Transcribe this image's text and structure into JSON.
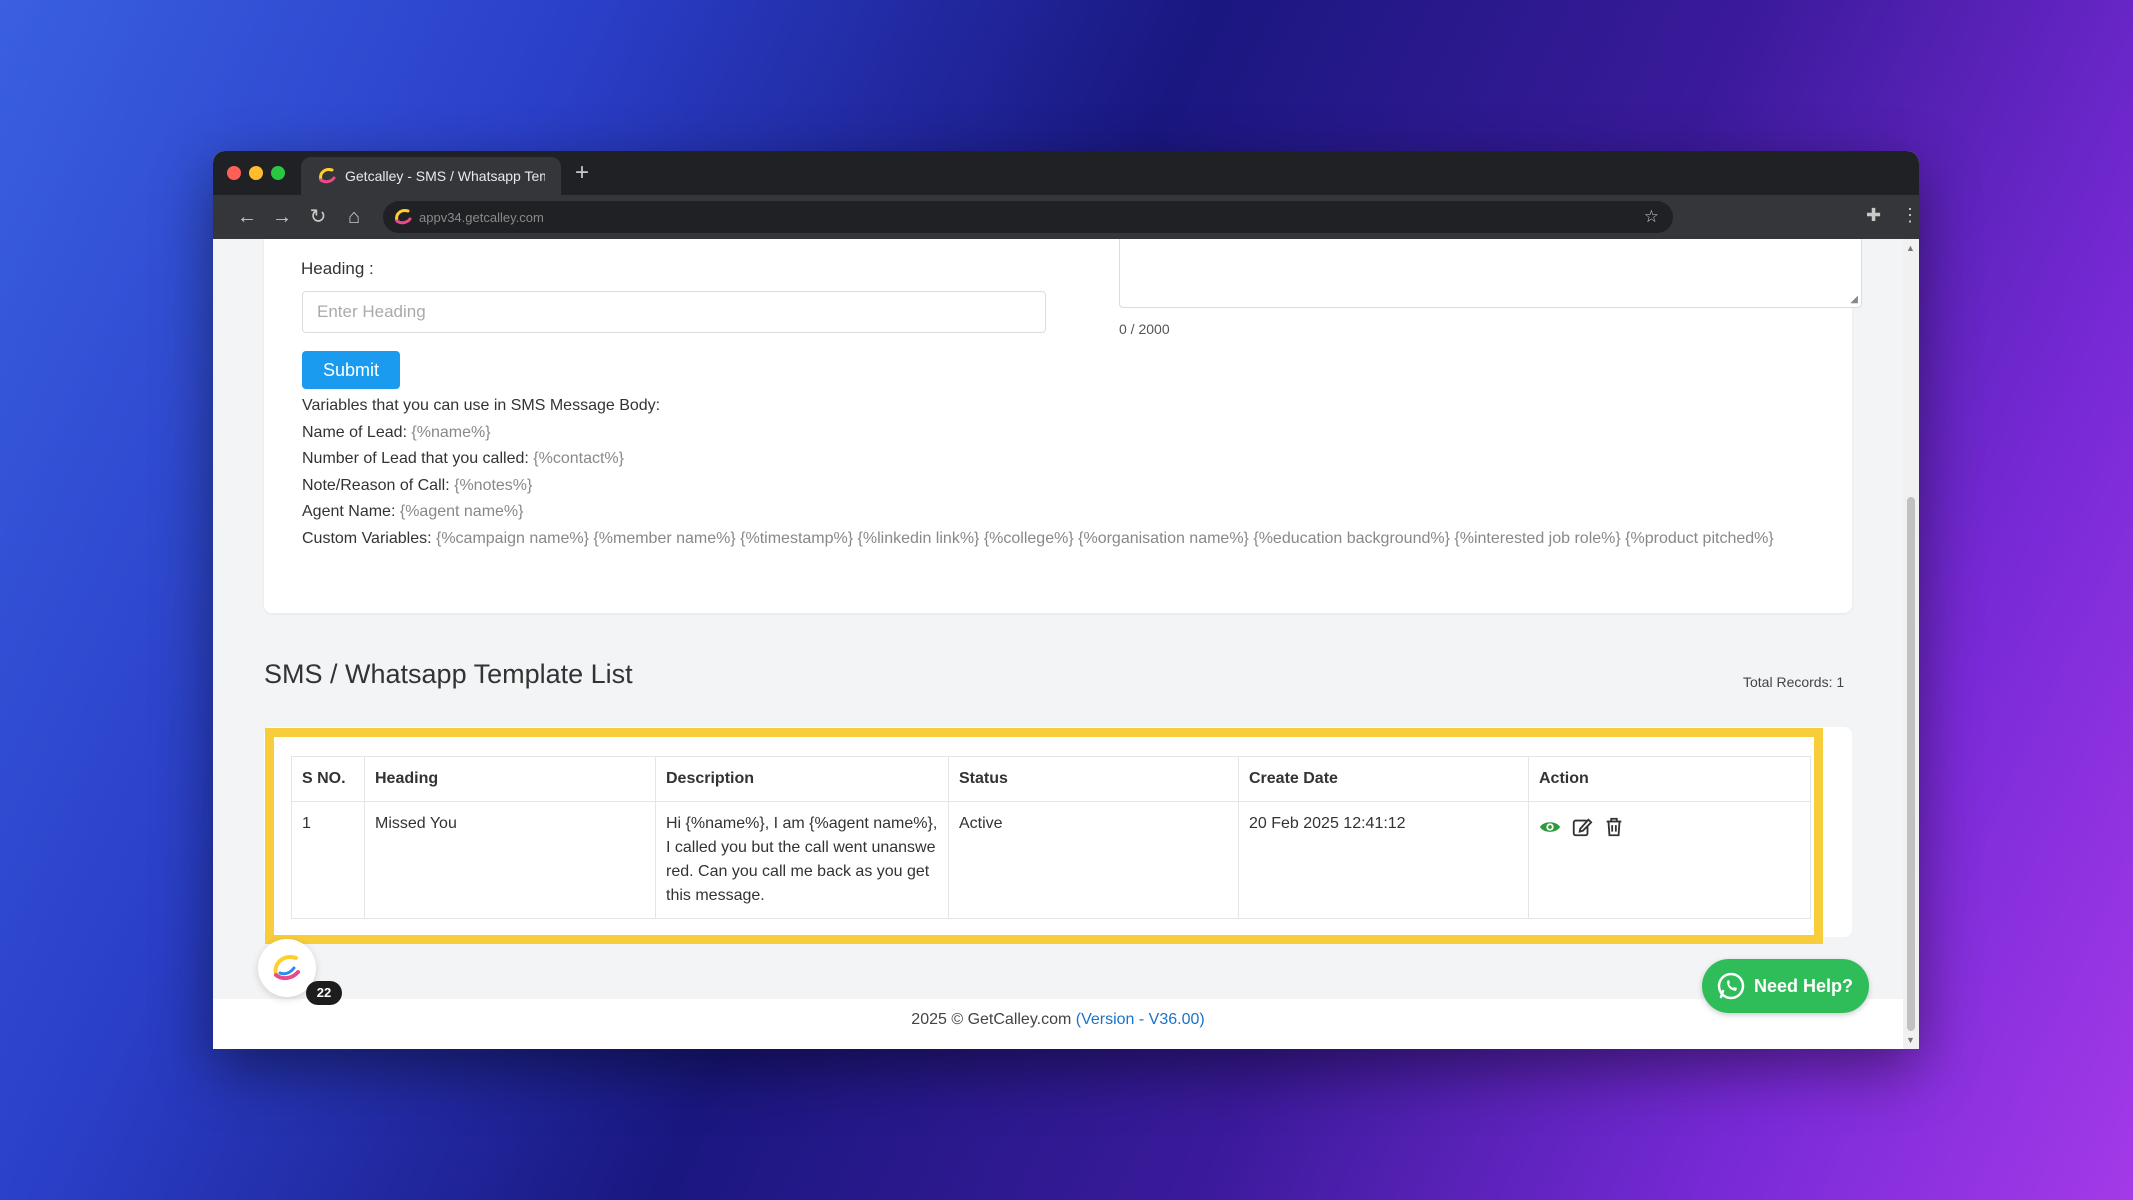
{
  "browser": {
    "tab_title": "Getcalley - SMS / Whatsapp Temp",
    "url": "appv34.getcalley.com"
  },
  "form": {
    "heading_label": "Heading :",
    "heading_placeholder": "Enter Heading",
    "heading_value": "",
    "char_counter": "0 / 2000",
    "submit_label": "Submit"
  },
  "variables": {
    "intro": "Variables that you can use in SMS Message Body:",
    "items": [
      {
        "label": "Name of Lead:",
        "value": "{%name%}"
      },
      {
        "label": "Number of Lead that you called:",
        "value": "{%contact%}"
      },
      {
        "label": "Note/Reason of Call:",
        "value": "{%notes%}"
      },
      {
        "label": "Agent Name:",
        "value": "{%agent name%}"
      },
      {
        "label": "Custom Variables:",
        "value": "{%campaign name%} {%member name%} {%timestamp%} {%linkedin link%} {%college%} {%organisation name%} {%education background%} {%interested job role%} {%product pitched%}"
      }
    ]
  },
  "list": {
    "title": "SMS / Whatsapp Template List",
    "total_records": "Total Records: 1",
    "columns": [
      "S NO.",
      "Heading",
      "Description",
      "Status",
      "Create Date",
      "Action"
    ],
    "rows": [
      {
        "sno": "1",
        "heading": "Missed You",
        "description": "Hi {%name%}, I am {%agent name%}, I called you but the call went unanswered. Can you call me back as you get this message.",
        "status": "Active",
        "create_date": "20 Feb 2025 12:41:12"
      }
    ]
  },
  "widgets": {
    "badge_count": "22",
    "help_label": "Need Help?"
  },
  "footer": {
    "copyright": "2025 © GetCalley.com ",
    "version": "(Version - V36.00)"
  },
  "colors": {
    "submit_bg": "#1a9bf0",
    "highlight": "#f7cd3b",
    "help_bg": "#2fbd59",
    "view_icon": "#2e9a3c"
  },
  "icons": {
    "view": "eye-icon",
    "edit": "edit-icon",
    "delete": "trash-icon",
    "help": "whatsapp-icon"
  }
}
